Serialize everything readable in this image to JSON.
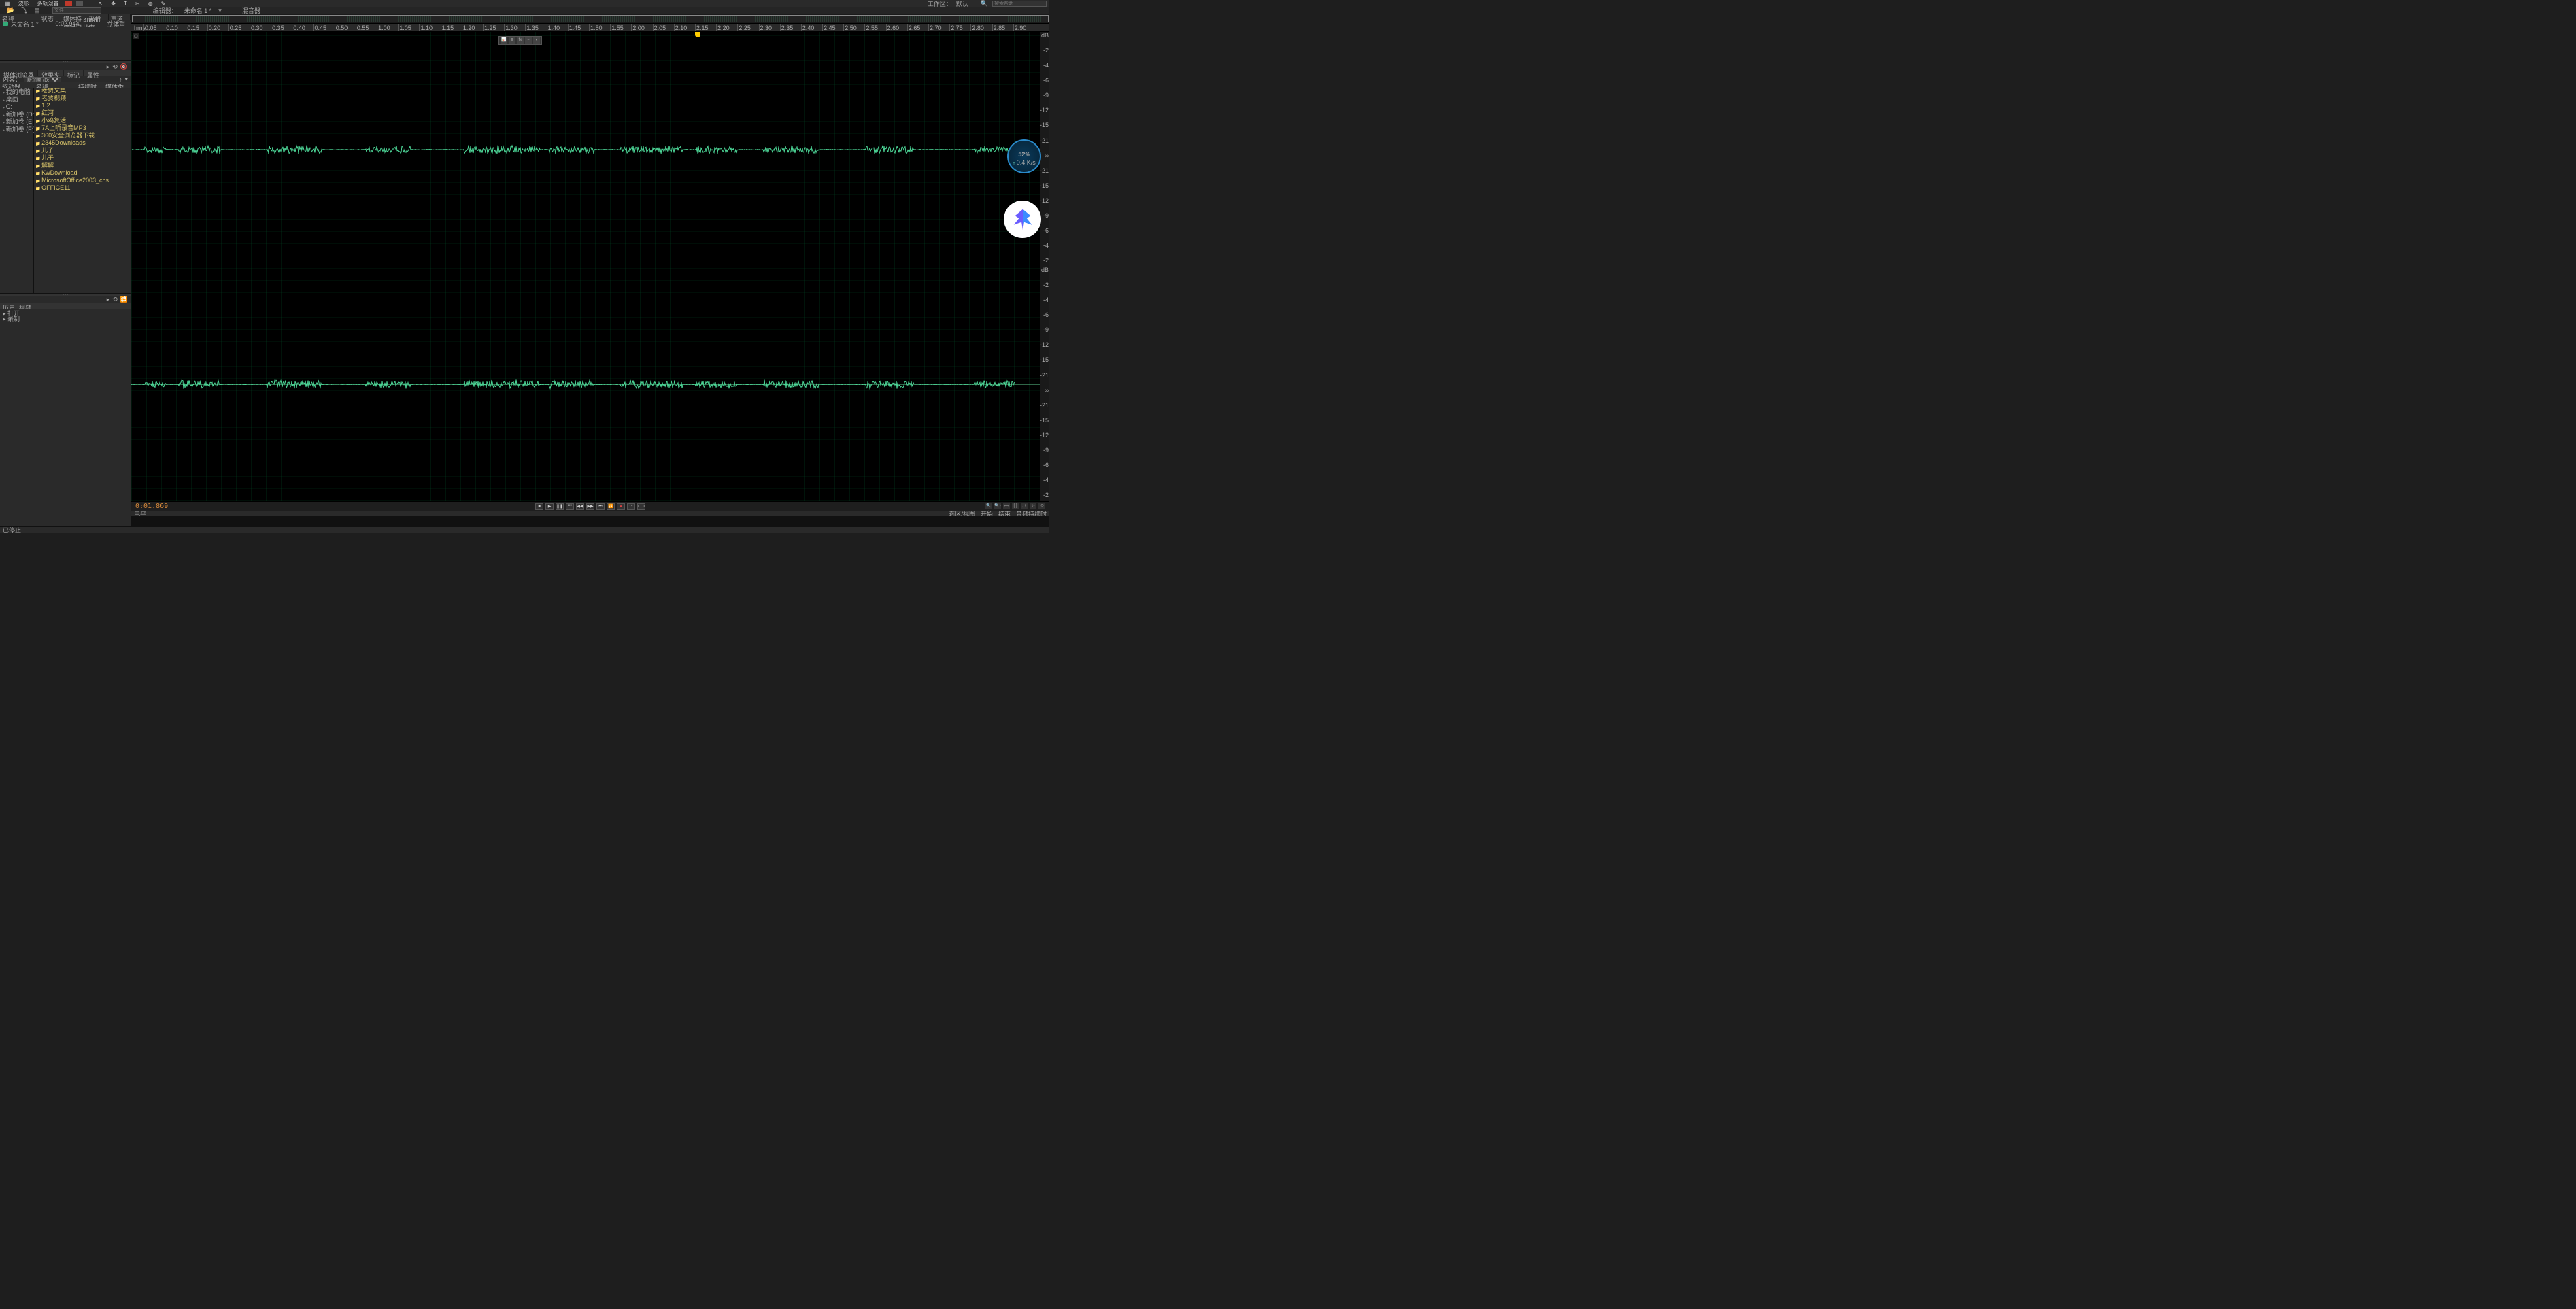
{
  "topbar": {
    "mode_waveform": "波形",
    "mode_multitrack": "多轨混音",
    "workspace_label": "工作区：",
    "workspace_value": "默认",
    "search_placeholder": "搜索帮助"
  },
  "tabbar": {
    "editor_label": "编辑器：",
    "editor_file": "未命名 1 *",
    "mixer": "混音器"
  },
  "files": {
    "panel_title": "文件",
    "cols": {
      "name": "名称",
      "status": "状态",
      "duration": "媒体持续时间",
      "sr": "采样率",
      "ch": "声道"
    },
    "open": {
      "name": "未命名 1 *",
      "duration": "0:02.944",
      "sr": "48000 Hz",
      "ch": "立体声"
    }
  },
  "media": {
    "tab_browser": "媒体浏览器",
    "tab_fx": "效果夹",
    "tab_marker": "标记",
    "tab_props": "属性",
    "filter_label": "内容：",
    "filter_value": "新加卷 (D:)",
    "col_drive": "驱动器",
    "col_name": "名称",
    "col_dur": "持续时间",
    "col_type": "媒体类型",
    "tree": [
      "我的电脑",
      "桌面",
      "C:",
      "新加卷 (D:)",
      "新加卷 (E:)",
      "新加卷 (F:)"
    ],
    "list": [
      "老贾文集",
      "老贾视频",
      "1.2",
      "红河",
      "小鸡复活",
      "7A上听录音MP3",
      "360安全浏览器下载",
      "2345Downloads",
      "儿子",
      "儿子",
      "解解",
      "KwDownload",
      "MicrosoftOffice2003_chs",
      "OFFICE11"
    ]
  },
  "history": {
    "tab_hist": "历史",
    "tab_video": "视频",
    "items": [
      "打开",
      "录制"
    ]
  },
  "ruler": {
    "unit": "hms",
    "ticks": [
      "0.05",
      "0.10",
      "0.15",
      "0.20",
      "0.25",
      "0.30",
      "0.35",
      "0.40",
      "0.45",
      "0.50",
      "0.55",
      "1.00",
      "1.05",
      "1.10",
      "1.15",
      "1.20",
      "1.25",
      "1.30",
      "1.35",
      "1.40",
      "1.45",
      "1.50",
      "1.55",
      "2.00",
      "2.05",
      "2.10",
      "2.15",
      "2.20",
      "2.25",
      "2.30",
      "2.35",
      "2.40",
      "2.45",
      "2.50",
      "2.55",
      "2.60",
      "2.65",
      "2.70",
      "2.75",
      "2.80",
      "2.85",
      "2.90"
    ]
  },
  "db_scale": [
    "dB",
    "-2",
    "-4",
    "-6",
    "-9",
    "-12",
    "-15",
    "-21",
    "∞",
    "-21",
    "-15",
    "-12",
    "-9",
    "-6",
    "-4",
    "-2"
  ],
  "time": "0:01.869",
  "levels_label": "电平",
  "sel": {
    "start_lbl": "选区/视图",
    "start": "开始",
    "end": "结束",
    "dur": "音频持续时"
  },
  "status": "已停止",
  "perf": {
    "pct": "52",
    "unit": "%",
    "speed": "0.4 K/s"
  }
}
